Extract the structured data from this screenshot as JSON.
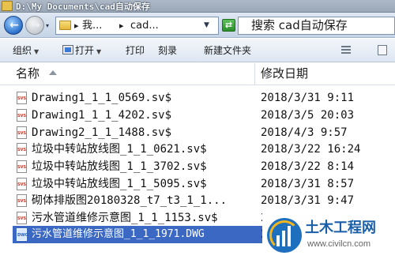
{
  "window": {
    "title": "D:\\My Documents\\cad自动保存"
  },
  "address": {
    "crumb1": "我...",
    "crumb2": "cad...",
    "search_text": "搜索 cad自动保存"
  },
  "toolbar": {
    "organize": "组织",
    "open": "打开",
    "print": "打印",
    "burn": "刻录",
    "new_folder": "新建文件夹"
  },
  "columns": {
    "name": "名称",
    "date_modified": "修改日期"
  },
  "files": [
    {
      "name": "Drawing1_1_1_0569.sv$",
      "date": "2018/3/31 9:11",
      "selected": false
    },
    {
      "name": "Drawing1_1_1_4202.sv$",
      "date": "2018/3/5 20:03",
      "selected": false
    },
    {
      "name": "Drawing2_1_1_1488.sv$",
      "date": "2018/4/3 9:57",
      "selected": false
    },
    {
      "name": "垃圾中转站放线图_1_1_0621.sv$",
      "date": "2018/3/22 16:24",
      "selected": false
    },
    {
      "name": "垃圾中转站放线图_1_1_3702.sv$",
      "date": "2018/3/22 8:14",
      "selected": false
    },
    {
      "name": "垃圾中转站放线图_1_1_5095.sv$",
      "date": "2018/3/31 8:57",
      "selected": false
    },
    {
      "name": "砌体排版图20180328_t7_t3_1_1...",
      "date": "2018/3/31 9:47",
      "selected": false
    },
    {
      "name": "污水管道维修示意图_1_1_1153.sv$",
      "date": "2",
      "selected": false
    },
    {
      "name": "污水管道维修示意图_1_1_1971.DWG",
      "date": "2",
      "selected": true
    }
  ],
  "watermark": {
    "title": "土木工程网",
    "url": "www.civilcn.com"
  }
}
